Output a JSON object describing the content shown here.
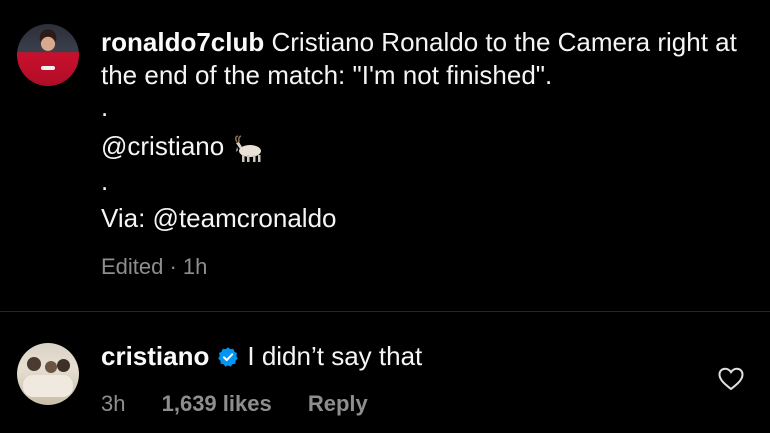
{
  "post": {
    "username": "ronaldo7club",
    "caption_text": "Cristiano Ronaldo to the Camera right at the end of the match: \"I'm not finished\".",
    "dot1": ".",
    "mention": "@cristiano",
    "mention_emoji": "goat-emoji",
    "dot2": ".",
    "via": "Via: @teamcronaldo",
    "meta": "Edited · 1h"
  },
  "reply": {
    "username": "cristiano",
    "text": "I didn’t say that",
    "time": "3h",
    "likes": "1,639 likes",
    "reply_label": "Reply",
    "verified_icon": "verified-badge-icon",
    "like_icon": "heart-icon"
  },
  "colors": {
    "background": "#000000",
    "text": "#f5f5f5",
    "muted": "#8e8e8e",
    "verified": "#0095f6"
  }
}
